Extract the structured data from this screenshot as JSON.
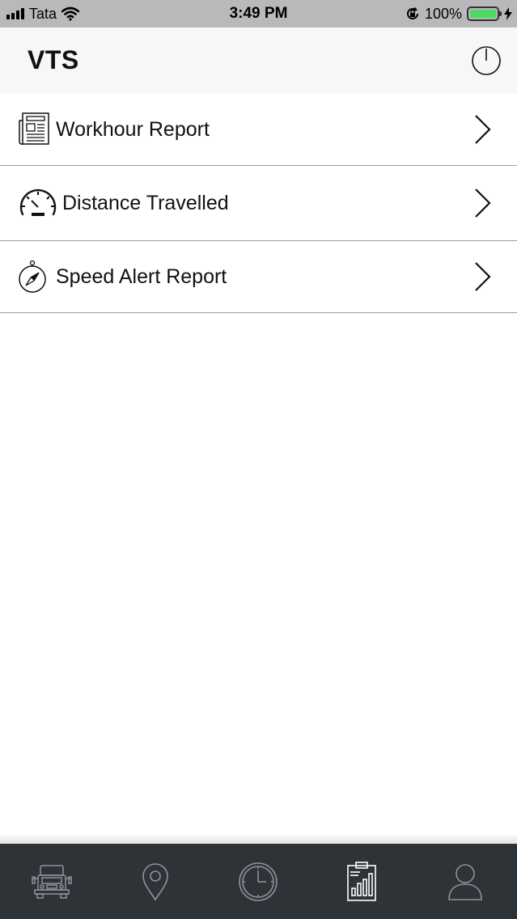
{
  "status_bar": {
    "carrier": "Tata",
    "time": "3:49 PM",
    "battery_percent": "100%",
    "icons": [
      "signal-icon",
      "wifi-icon",
      "orientation-lock-icon",
      "battery-icon",
      "charging-bolt-icon"
    ]
  },
  "nav": {
    "title": "VTS",
    "power_icon": "power-icon"
  },
  "reports": [
    {
      "label": "Workhour Report",
      "icon": "newspaper-report-icon"
    },
    {
      "label": "Distance Travelled",
      "icon": "speedometer-icon"
    },
    {
      "label": "Speed Alert Report",
      "icon": "compass-icon"
    }
  ],
  "tab_bar": {
    "tabs": [
      {
        "icon": "truck-icon",
        "selected": false
      },
      {
        "icon": "location-pin-icon",
        "selected": false
      },
      {
        "icon": "clock-icon",
        "selected": false
      },
      {
        "icon": "reports-clipboard-icon",
        "selected": true
      },
      {
        "icon": "user-profile-icon",
        "selected": false
      }
    ]
  },
  "colors": {
    "status_bar_bg": "#b9b9bb",
    "nav_bg": "#f7f7f7",
    "tab_bar_bg": "#2e3338",
    "tab_icon_inactive": "#8e939a",
    "tab_icon_active": "#ffffff",
    "battery_fill": "#4cd964"
  }
}
